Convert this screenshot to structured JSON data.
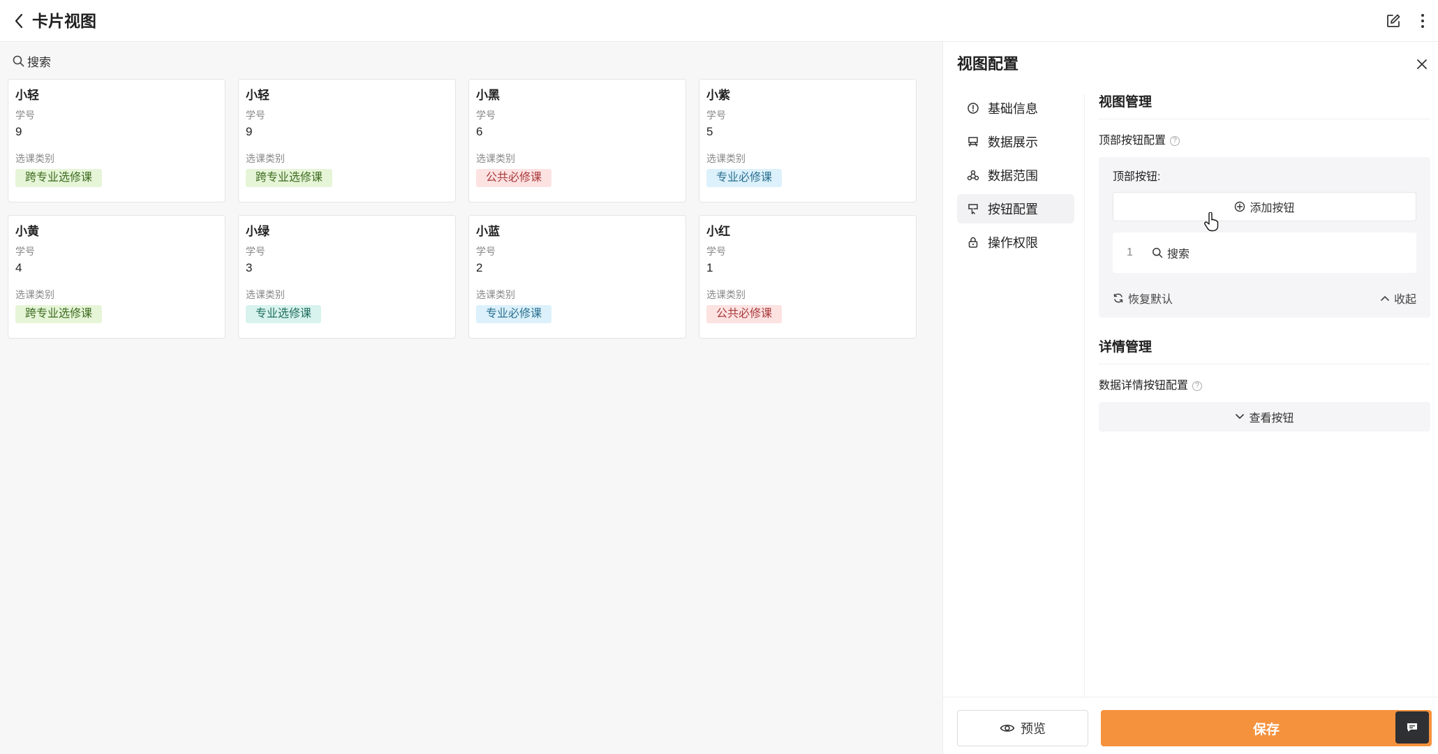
{
  "header": {
    "title": "卡片视图"
  },
  "search": {
    "placeholder": "搜索"
  },
  "cards": [
    {
      "name": "小轻",
      "id_label": "学号",
      "id_value": "9",
      "category_label": "选课类别",
      "tag": "跨专业选修课",
      "tag_bg": "#e6f5d8",
      "tag_fg": "#3d6b1f"
    },
    {
      "name": "小轻",
      "id_label": "学号",
      "id_value": "9",
      "category_label": "选课类别",
      "tag": "跨专业选修课",
      "tag_bg": "#e6f5d8",
      "tag_fg": "#3d6b1f"
    },
    {
      "name": "小黑",
      "id_label": "学号",
      "id_value": "6",
      "category_label": "选课类别",
      "tag": "公共必修课",
      "tag_bg": "#fde2e2",
      "tag_fg": "#a83a3a"
    },
    {
      "name": "小紫",
      "id_label": "学号",
      "id_value": "5",
      "category_label": "选课类别",
      "tag": "专业必修课",
      "tag_bg": "#dcf1fb",
      "tag_fg": "#2a6f8f"
    },
    {
      "name": "小黄",
      "id_label": "学号",
      "id_value": "4",
      "category_label": "选课类别",
      "tag": "跨专业选修课",
      "tag_bg": "#e6f5d8",
      "tag_fg": "#3d6b1f"
    },
    {
      "name": "小绿",
      "id_label": "学号",
      "id_value": "3",
      "category_label": "选课类别",
      "tag": "专业选修课",
      "tag_bg": "#d8f3ee",
      "tag_fg": "#1f6d5f"
    },
    {
      "name": "小蓝",
      "id_label": "学号",
      "id_value": "2",
      "category_label": "选课类别",
      "tag": "专业必修课",
      "tag_bg": "#dcf1fb",
      "tag_fg": "#2a6f8f"
    },
    {
      "name": "小红",
      "id_label": "学号",
      "id_value": "1",
      "category_label": "选课类别",
      "tag": "公共必修课",
      "tag_bg": "#fde2e2",
      "tag_fg": "#a83a3a"
    }
  ],
  "panel": {
    "title": "视图配置",
    "nav": [
      {
        "label": "基础信息",
        "icon": "info-circle-icon",
        "active": false
      },
      {
        "label": "数据展示",
        "icon": "display-icon",
        "active": false
      },
      {
        "label": "数据范围",
        "icon": "range-icon",
        "active": false
      },
      {
        "label": "按钮配置",
        "icon": "button-config-icon",
        "active": true
      },
      {
        "label": "操作权限",
        "icon": "lock-icon",
        "active": false
      }
    ],
    "view_management": {
      "title": "视图管理",
      "top_button_config_label": "顶部按钮配置",
      "top_buttons_label": "顶部按钮:",
      "add_button_label": "添加按钮",
      "buttons": [
        {
          "index": "1",
          "label": "搜索"
        }
      ],
      "restore_default_label": "恢复默认",
      "collapse_label": "收起"
    },
    "detail_management": {
      "title": "详情管理",
      "detail_button_config_label": "数据详情按钮配置",
      "view_buttons_label": "查看按钮"
    },
    "footer": {
      "preview_label": "预览",
      "save_label": "保存"
    }
  }
}
